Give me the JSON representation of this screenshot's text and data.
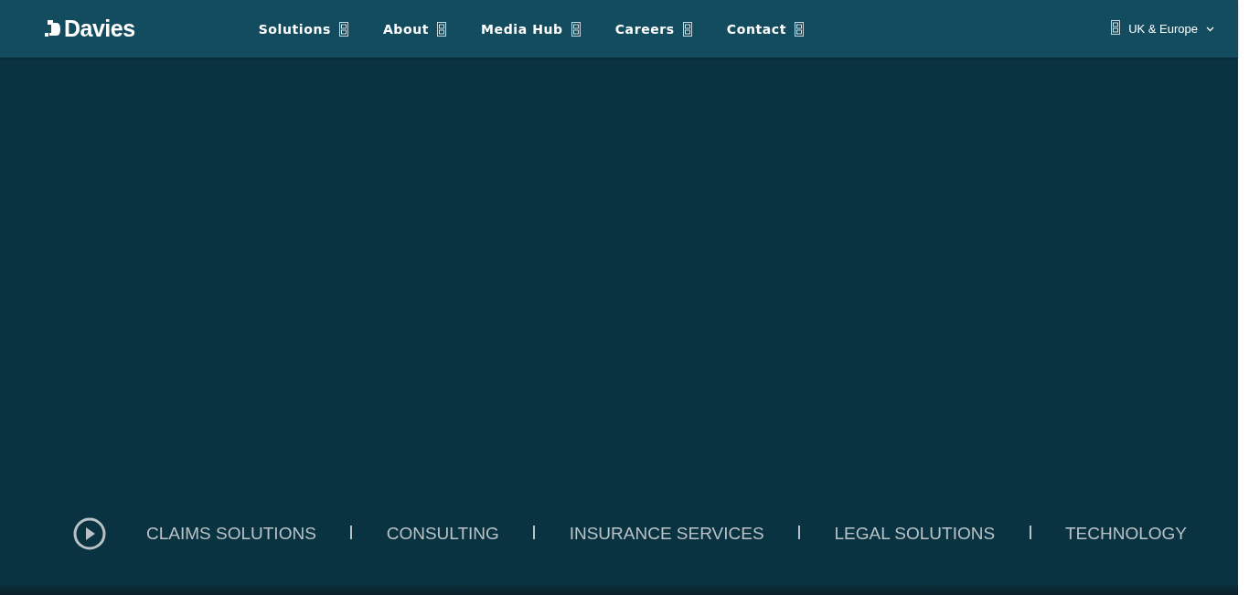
{
  "header": {
    "logo": "Davies",
    "nav": [
      {
        "label": "Solutions"
      },
      {
        "label": "About"
      },
      {
        "label": "Media Hub"
      },
      {
        "label": "Careers"
      },
      {
        "label": "Contact"
      }
    ],
    "region": {
      "label": "UK & Europe"
    }
  },
  "hero": {
    "categories": [
      {
        "label": "CLAIMS SOLUTIONS"
      },
      {
        "label": "CONSULTING"
      },
      {
        "label": "INSURANCE SERVICES"
      },
      {
        "label": "LEGAL SOLUTIONS"
      },
      {
        "label": "TECHNOLOGY"
      }
    ]
  }
}
